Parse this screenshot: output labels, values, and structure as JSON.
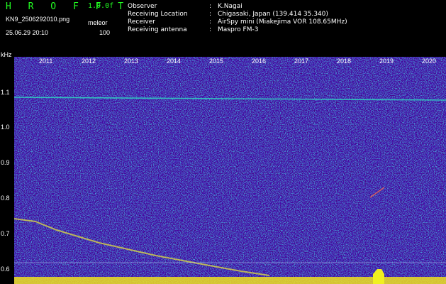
{
  "header": {
    "app_title": "H R O F F T",
    "version": "1.0.0f",
    "filename": "KN9_2506292010.png",
    "mode": "meleor",
    "datetime": "25.06.29 20:10",
    "gain": "100"
  },
  "meta": [
    {
      "key": "Observer",
      "value": "K.Nagai"
    },
    {
      "key": "Receiving Location",
      "value": "Chigasaki, Japan (139.414 35.340)"
    },
    {
      "key": "Receiver",
      "value": "AirSpy mini (Miakejima VOR 108.65MHz)"
    },
    {
      "key": "Receiving antenna",
      "value": "Maspro FM-3"
    }
  ],
  "axis": {
    "unit": "kHz",
    "y_labels": [
      "1.1",
      "1.0",
      "0.9",
      "0.8",
      "0.7",
      "0.6"
    ],
    "x_labels": [
      "2011",
      "2012",
      "2013",
      "2014",
      "2015",
      "2016",
      "2017",
      "2018",
      "2019",
      "2020"
    ]
  },
  "colors": {
    "background": "#000000",
    "title_green": "#22ff22",
    "spectrum_base": "#0a2a9a",
    "carrier_line": "#30d0c0",
    "noise_band": "#f0e020"
  }
}
